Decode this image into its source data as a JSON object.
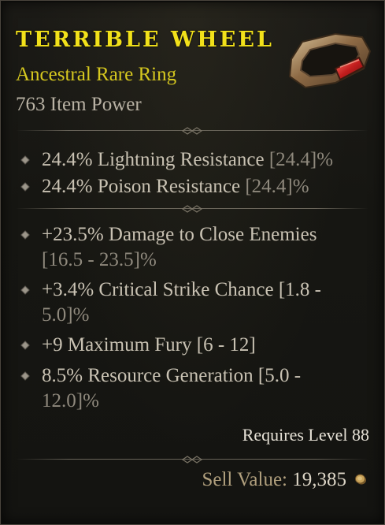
{
  "item": {
    "name": "Terrible Wheel",
    "type": "Ancestral Rare Ring",
    "item_power": "763 Item Power",
    "image_icon": "ring-icon"
  },
  "implicit_affixes": [
    {
      "text": "24.4% Lightning Resistance",
      "range": "[24.4]%"
    },
    {
      "text": "24.4% Poison Resistance",
      "range": "[24.4]%"
    }
  ],
  "affixes": [
    {
      "line1": "+23.5% Damage to Close Enemies",
      "line2": "[16.5 - 23.5]%"
    },
    {
      "line1": "+3.4% Critical Strike Chance [1.8 -",
      "line2": "5.0]%"
    },
    {
      "line1": "+9 Maximum Fury [6 - 12]"
    },
    {
      "line1": "8.5% Resource Generation [5.0 -",
      "line2": "12.0]%"
    }
  ],
  "requirements": "Requires Level 88",
  "sell": {
    "label": "Sell Value:",
    "value": "19,385",
    "icon": "gold-coin-icon"
  },
  "colors": {
    "title": "#f2e11a",
    "rarity": "#d6c81f",
    "text": "#c9c2b3"
  }
}
